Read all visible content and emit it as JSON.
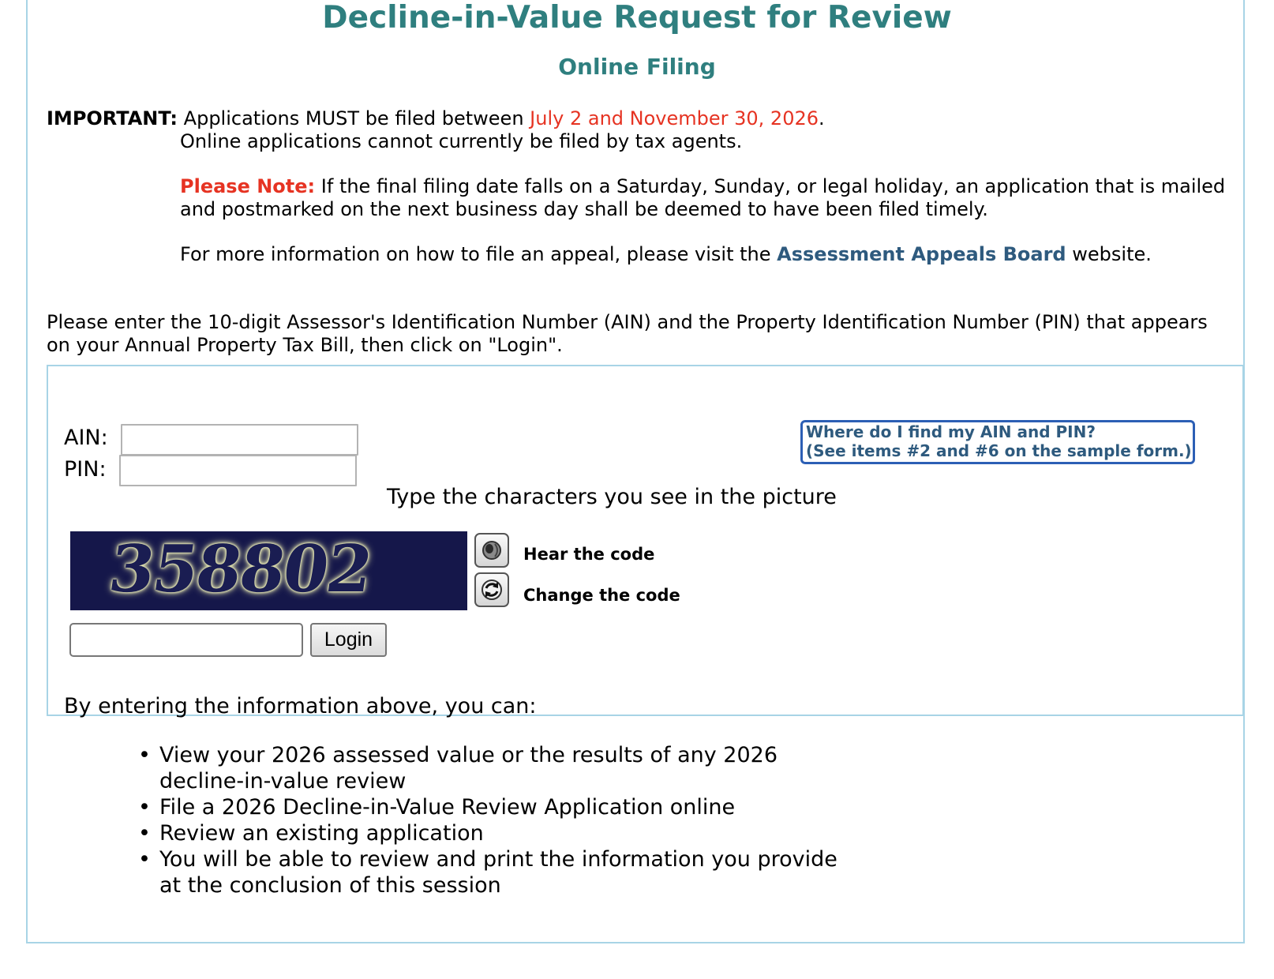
{
  "header": {
    "title": "Decline-in-Value Request for Review",
    "subtitle": "Online Filing"
  },
  "notice": {
    "important_label": "IMPORTANT:",
    "important_text": "Applications MUST be filed between",
    "date_range": "July 2 and November 30, 2026",
    "period": ".",
    "agents_text": "Online applications cannot currently be filed by tax agents.",
    "note_label": "Please Note:",
    "note_line1": "If the final filing date falls on a Saturday, Sunday, or legal holiday, an application that is mailed",
    "note_line2": "and postmarked on the next business day shall be deemed to have been filed timely.",
    "info_prefix": "For more information on how to file an appeal, please visit the",
    "info_link": "Assessment Appeals Board",
    "info_suffix": "website."
  },
  "instructions": {
    "line1": "Please enter the 10-digit Assessor's Identification Number (AIN) and the Property Identification Number (PIN) that appears",
    "line2": "on your Annual Property Tax Bill, then click on \"Login\"."
  },
  "login_form": {
    "ain_label": "AIN:",
    "ain_value": "",
    "pin_label": "PIN:",
    "pin_value": "",
    "help_line1": "Where do I find my AIN and PIN?",
    "help_line2": "(See items #2 and #6 on the sample form.)",
    "captcha_prompt": "Type the characters you see in the picture",
    "captcha_code": "358802",
    "hear_code_label": "Hear the code",
    "hear_code_icon": "speaker-icon",
    "change_code_label": "Change the code",
    "change_code_icon": "refresh-icon",
    "captcha_value": "",
    "login_label": "Login"
  },
  "benefits": {
    "intro": "By entering the information above, you can:",
    "items": [
      "View your 2026 assessed value or the results of any 2026",
      "decline-in-value review",
      "File a 2026 Decline-in-Value Review Application online",
      "Review an existing application",
      "You will be able to review and print the information you provide",
      "at the conclusion of this session"
    ]
  },
  "colors": {
    "heading": "#2f7f7f",
    "alert_red": "#e63322",
    "link_blue": "#2e5a7e",
    "frame_border": "#a8d4e6",
    "help_border": "#2c5fb5",
    "captcha_bg": "#15174a"
  }
}
